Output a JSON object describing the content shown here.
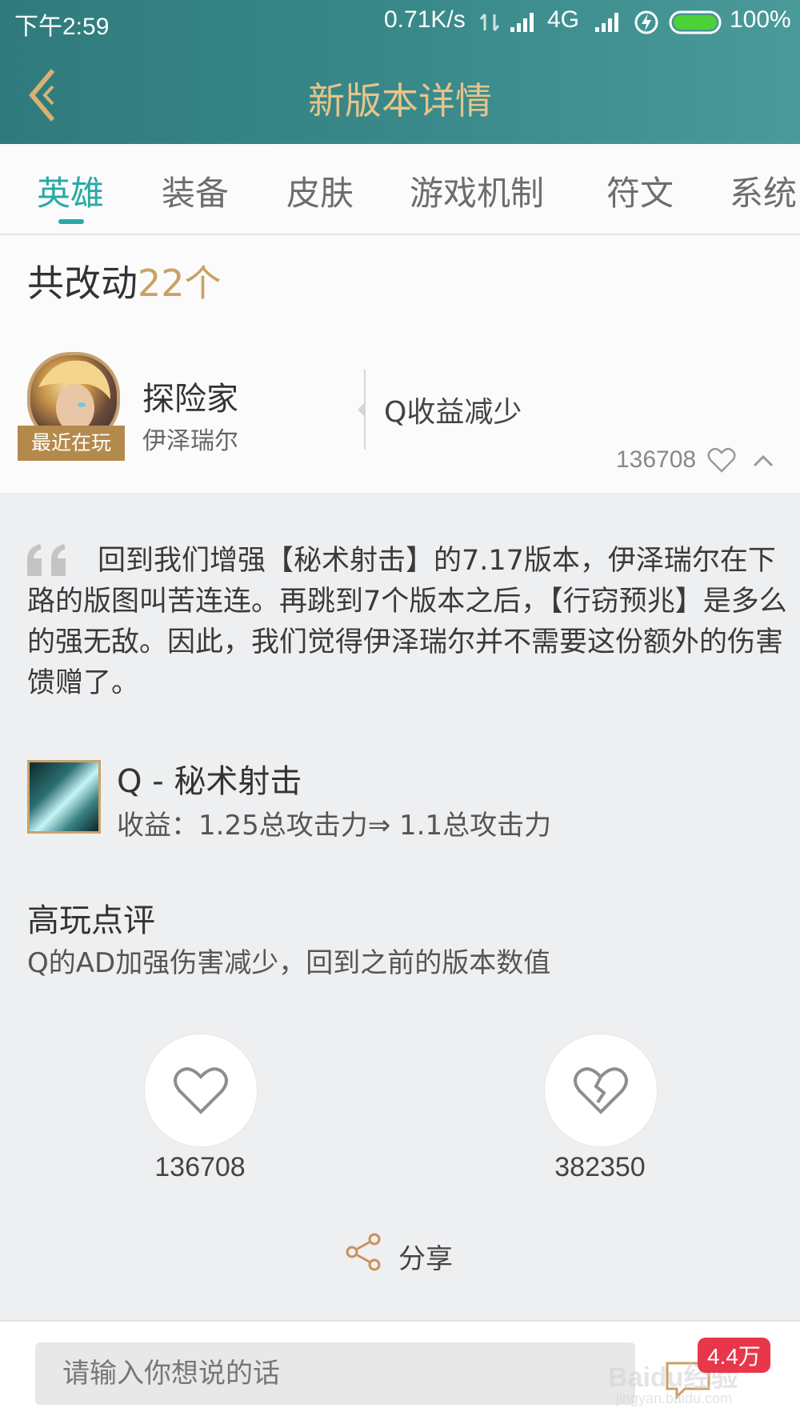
{
  "status_bar": {
    "time": "下午2:59",
    "network_speed": "0.71K/s",
    "network_type": "4G",
    "battery": "100%"
  },
  "header": {
    "title": "新版本详情",
    "back_icon": "back-chevron-icon"
  },
  "tabs": [
    {
      "label": "英雄",
      "active": true
    },
    {
      "label": "装备",
      "active": false
    },
    {
      "label": "皮肤",
      "active": false
    },
    {
      "label": "游戏机制",
      "active": false
    },
    {
      "label": "符文",
      "active": false
    },
    {
      "label": "系统",
      "active": false
    }
  ],
  "summary": {
    "prefix": "共改动",
    "count": "22个"
  },
  "champion": {
    "title": "探险家",
    "name": "伊泽瑞尔",
    "badge": "最近在玩",
    "change_summary": "Q收益减少",
    "likes": "136708"
  },
  "details": {
    "description": "回到我们增强【秘术射击】的7.17版本，伊泽瑞尔在下路的版图叫苦连连。再跳到7个版本之后，【行窃预兆】是多么的强无敌。因此，我们觉得伊泽瑞尔并不需要这份额外的伤害馈赠了。",
    "skill_name": "Q - 秘术射击",
    "skill_change": "收益：1.25总攻击力⇒ 1.1总攻击力",
    "review_title": "高玩点评",
    "review_text": "Q的AD加强伤害减少，回到之前的版本数值",
    "like_count": "136708",
    "dislike_count": "382350",
    "share_label": "分享"
  },
  "comment_bar": {
    "placeholder": "请输入你想说的话",
    "comment_count": "4.4万",
    "watermark": "Baidu经验",
    "watermark_url": "jingyan.baidu.com"
  },
  "colors": {
    "header_teal": "#2f7a7c",
    "title_gold": "#e6c48a",
    "active_tab": "#2aa9a5",
    "count_gold": "#caa164",
    "badge_brown": "#b48a4c",
    "comment_badge_red": "#e8374a"
  }
}
